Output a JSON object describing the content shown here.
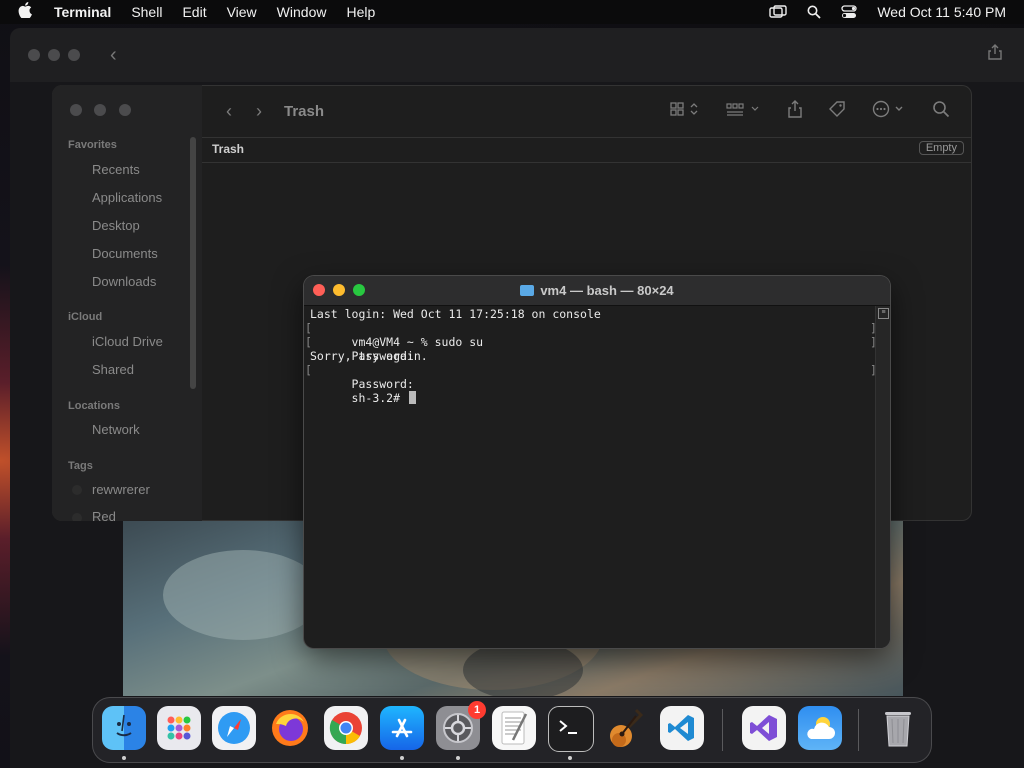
{
  "menubar": {
    "app_name": "Terminal",
    "menus": [
      "Shell",
      "Edit",
      "View",
      "Window",
      "Help"
    ],
    "clock": "Wed Oct 11  5:40 PM"
  },
  "finder": {
    "title": "Trash",
    "header_title": "Trash",
    "empty_button": "Empty",
    "sidebar": {
      "favorites_label": "Favorites",
      "favorites": [
        "Recents",
        "Applications",
        "Desktop",
        "Documents",
        "Downloads"
      ],
      "icloud_label": "iCloud",
      "icloud": [
        "iCloud Drive",
        "Shared"
      ],
      "locations_label": "Locations",
      "locations": [
        "Network"
      ],
      "tags_label": "Tags",
      "tags": [
        "rewwrerer",
        "Red"
      ]
    }
  },
  "terminal": {
    "title": "vm4 — bash — 80×24",
    "lines": [
      "Last login: Wed Oct 11 17:25:18 on console",
      "vm4@VM4 ~ % sudo su",
      "Password:",
      "Sorry, try again.",
      "Password:",
      "sh-3.2# "
    ]
  },
  "dock": {
    "apps": [
      {
        "name": "Finder",
        "running": true
      },
      {
        "name": "Launchpad",
        "running": false
      },
      {
        "name": "Safari",
        "running": false
      },
      {
        "name": "Firefox",
        "running": false
      },
      {
        "name": "Chrome",
        "running": false
      },
      {
        "name": "App Store",
        "running": true
      },
      {
        "name": "System Settings",
        "running": true,
        "badge": "1"
      },
      {
        "name": "TextEdit",
        "running": false
      },
      {
        "name": "Terminal",
        "running": true
      },
      {
        "name": "GarageBand",
        "running": false
      },
      {
        "name": "Visual Studio Code",
        "running": false
      },
      {
        "name": "Visual Studio",
        "running": false
      },
      {
        "name": "Weather",
        "running": false
      },
      {
        "name": "Trash",
        "running": false
      }
    ]
  },
  "colors": {
    "close": "#ff5f57",
    "minimize": "#febc2e",
    "maximize": "#28c840",
    "badge": "#ff3b30"
  }
}
